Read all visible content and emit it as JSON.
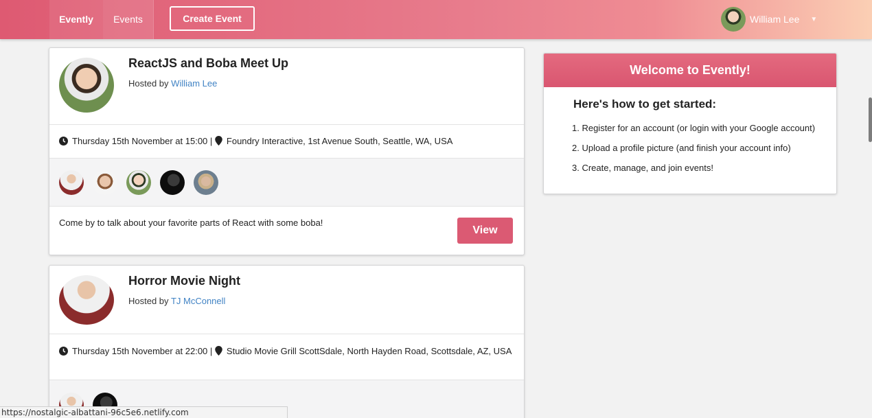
{
  "nav": {
    "brand": "Evently",
    "events": "Events",
    "create_event": "Create Event",
    "user_name": "William Lee"
  },
  "events": [
    {
      "title": "ReactJS and Boba Meet Up",
      "hosted_by_label": "Hosted by",
      "host": "William Lee",
      "date": "Thursday 15th November at 15:00 |",
      "venue": "Foundry Interactive, 1st Avenue South, Seattle, WA, USA",
      "attendees": [
        "attendee-1",
        "attendee-2",
        "attendee-3",
        "attendee-4",
        "attendee-5"
      ],
      "description": "Come by to talk about your favorite parts of React with some boba!",
      "view_label": "View"
    },
    {
      "title": "Horror Movie Night",
      "hosted_by_label": "Hosted by",
      "host": "TJ McConnell",
      "date": "Thursday 15th November at 22:00 |",
      "venue": "Studio Movie Grill ScottSdale, North Hayden Road, Scottsdale, AZ, USA",
      "attendees": [
        "attendee-1",
        "attendee-2"
      ]
    }
  ],
  "welcome": {
    "title": "Welcome to Evently!",
    "subtitle": "Here's how to get started:",
    "steps": [
      "1. Register for an account (or login with your Google account)",
      "2. Upload a profile picture (and finish your account info)",
      "3. Create, manage, and join events!"
    ]
  },
  "status_bar": {
    "url": "https://nostalgic-albattani-96c5e6.netlify.com"
  },
  "colors": {
    "accent": "#db5a73",
    "link": "#4183c4"
  },
  "icons": [
    "clock-icon",
    "map-pin-icon",
    "chevron-down-icon"
  ]
}
